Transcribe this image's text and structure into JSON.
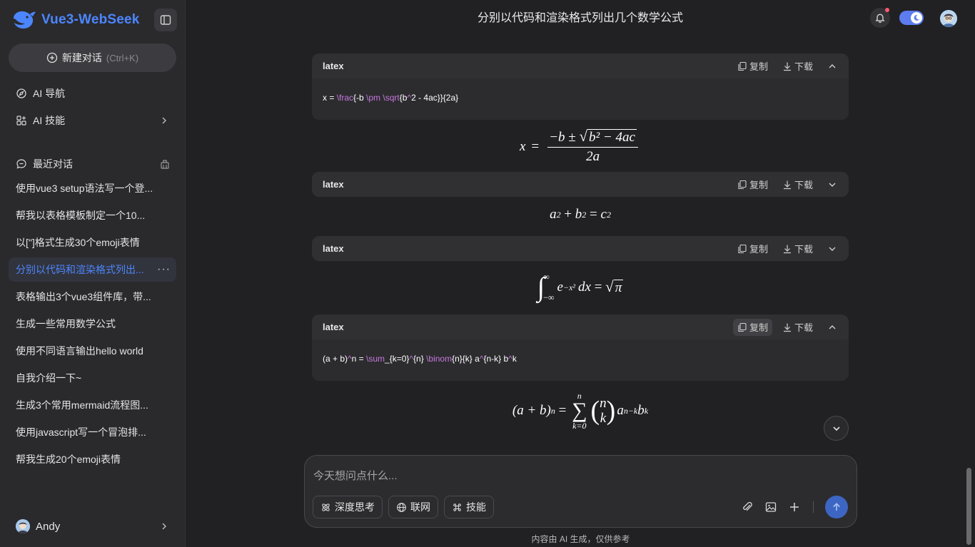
{
  "sidebar": {
    "brand": "Vue3-WebSeek",
    "new_chat": {
      "label": "新建对话",
      "shortcut": "(Ctrl+K)"
    },
    "nav": [
      {
        "label": "AI 导航"
      },
      {
        "label": "AI 技能"
      }
    ],
    "recent_header": "最近对话",
    "conversations": [
      {
        "label": "使用vue3 setup语法写一个登..."
      },
      {
        "label": "帮我以表格模板制定一个10..."
      },
      {
        "label": "以[\"]格式生成30个emoji表情"
      },
      {
        "label": "分别以代码和渲染格式列出...",
        "more": "···"
      },
      {
        "label": "表格输出3个vue3组件库，带..."
      },
      {
        "label": "生成一些常用数学公式"
      },
      {
        "label": "使用不同语言输出hello world"
      },
      {
        "label": "自我介绍一下~"
      },
      {
        "label": "生成3个常用mermaid流程图..."
      },
      {
        "label": "使用javascript写一个冒泡排..."
      },
      {
        "label": "帮我生成20个emoji表情"
      }
    ],
    "user": {
      "name": "Andy"
    }
  },
  "header": {
    "title": "分别以代码和渲染格式列出几个数学公式"
  },
  "code_blocks": [
    {
      "lang": "latex",
      "copy": "复制",
      "download": "下载",
      "tokens": [
        "x = ",
        "\\frac",
        "{-b ",
        "\\pm",
        " ",
        "\\sqrt",
        "{b",
        "^",
        "2 - 4ac}}{2a}"
      ]
    },
    {
      "lang": "latex",
      "copy": "复制",
      "download": "下载"
    },
    {
      "lang": "latex",
      "copy": "复制",
      "download": "下载"
    },
    {
      "lang": "latex",
      "copy": "复制",
      "download": "下载",
      "tokens": [
        "(a + b)",
        "^",
        "n = ",
        "\\sum",
        "_{k=0}",
        "^",
        "{n} ",
        "\\binom",
        "{n}{k} a",
        "^",
        "{n-k} b",
        "^",
        "k"
      ]
    }
  ],
  "math": {
    "quadratic": {
      "lhs": "x",
      "eq": "=",
      "minus_b": "−b ± ",
      "radicand": "b² − 4ac",
      "den": "2a"
    },
    "pythag": {
      "a": "a",
      "b": "b",
      "c": "c",
      "exp": "2",
      "plus": " + ",
      "eq": " = "
    },
    "gaussian": {
      "upper": "∞",
      "lower": "−∞",
      "body": "e",
      "exp": "−x²",
      "dx": "dx",
      "eq": " = ",
      "root": "π"
    },
    "binomial": {
      "lhs": "(a + b)",
      "lhs_exp": "n",
      "eq": " = ",
      "sum_top": "n",
      "sum_bottom": "k=0",
      "top": "n",
      "bottom": "k",
      "a": "a",
      "a_exp": "n−k",
      "b": "b",
      "b_exp": "k"
    }
  },
  "composer": {
    "placeholder": "今天想问点什么...",
    "chips": [
      {
        "label": "深度思考"
      },
      {
        "label": "联网"
      },
      {
        "label": "技能"
      }
    ]
  },
  "disclaimer": "内容由 AI 生成，仅供参考",
  "colors": {
    "accent": "#4c86ff",
    "keyword": "#c678dd",
    "send": "#3d66c4",
    "notify": "#ff5a6e"
  }
}
